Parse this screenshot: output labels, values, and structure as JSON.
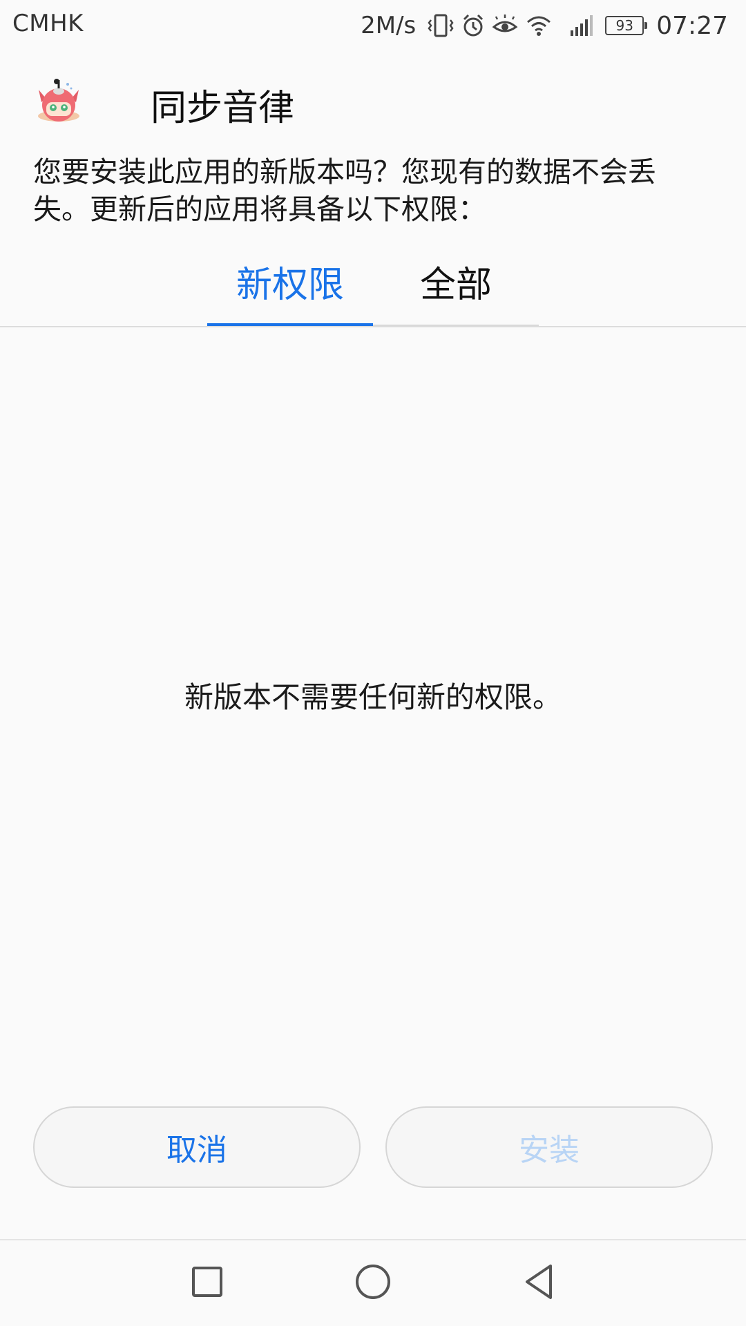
{
  "status_bar": {
    "carrier": "CMHK",
    "network_speed": "2M/s",
    "battery_level": "93",
    "time": "07:27",
    "icons": [
      "vibrate-icon",
      "alarm-icon",
      "eye-comfort-icon",
      "wifi-icon",
      "signal-icon",
      "battery-icon"
    ]
  },
  "header": {
    "app_name": "同步音律",
    "prompt": "您要安装此应用的新版本吗？您现有的数据不会丢失。更新后的应用将具备以下权限："
  },
  "tabs": [
    {
      "label": "新权限",
      "active": true
    },
    {
      "label": "全部",
      "active": false
    }
  ],
  "content": {
    "message": "新版本不需要任何新的权限。"
  },
  "buttons": {
    "cancel_label": "取消",
    "install_label": "安装"
  },
  "navigation": {
    "icons": [
      "recent-apps-icon",
      "home-icon",
      "back-icon"
    ]
  },
  "colors": {
    "accent": "#1a73e8",
    "install_disabled": "#b8d4f5",
    "background": "#fafafa"
  }
}
